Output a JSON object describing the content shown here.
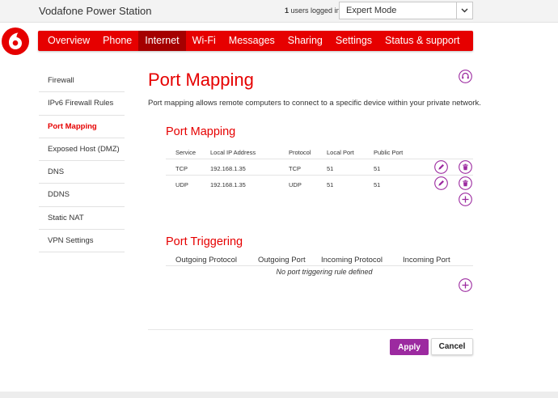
{
  "header": {
    "title": "Vodafone Power Station",
    "users_count": "1",
    "users_text": "users logged in",
    "mode_selected": "Expert Mode"
  },
  "colors": {
    "brand_red": "#e60000",
    "nav_active": "#a50000",
    "accent_purple": "#9c2aa0"
  },
  "nav": [
    {
      "label": "Overview"
    },
    {
      "label": "Phone"
    },
    {
      "label": "Internet",
      "active": true
    },
    {
      "label": "Wi-Fi"
    },
    {
      "label": "Messages"
    },
    {
      "label": "Sharing"
    },
    {
      "label": "Settings"
    },
    {
      "label": "Status & support"
    }
  ],
  "sidebar": [
    {
      "label": "Firewall"
    },
    {
      "label": "IPv6 Firewall Rules"
    },
    {
      "label": "Port Mapping",
      "active": true
    },
    {
      "label": "Exposed Host (DMZ)"
    },
    {
      "label": "DNS"
    },
    {
      "label": "DDNS"
    },
    {
      "label": "Static NAT"
    },
    {
      "label": "VPN Settings"
    }
  ],
  "page": {
    "title": "Port Mapping",
    "description": "Port mapping allows remote computers to connect to a specific device within your private network."
  },
  "port_mapping": {
    "title": "Port Mapping",
    "columns": [
      "Service",
      "Local IP Address",
      "Protocol",
      "Local Port",
      "Public Port"
    ],
    "rows": [
      {
        "service": "TCP",
        "ip": "192.168.1.35",
        "protocol": "TCP",
        "local_port": "51",
        "public_port": "51"
      },
      {
        "service": "UDP",
        "ip": "192.168.1.35",
        "protocol": "UDP",
        "local_port": "51",
        "public_port": "51"
      }
    ]
  },
  "port_triggering": {
    "title": "Port Triggering",
    "columns": [
      "Outgoing Protocol",
      "Outgoing Port",
      "Incoming Protocol",
      "Incoming Port"
    ],
    "empty_text": "No port triggering rule defined"
  },
  "actions": {
    "apply_label": "Apply",
    "cancel_label": "Cancel"
  },
  "icons": {
    "help": "headset-icon",
    "edit": "pencil-icon",
    "delete": "trash-icon",
    "add": "plus-icon",
    "dropdown": "chevron-down-icon",
    "logo": "vodafone-logo-icon"
  }
}
